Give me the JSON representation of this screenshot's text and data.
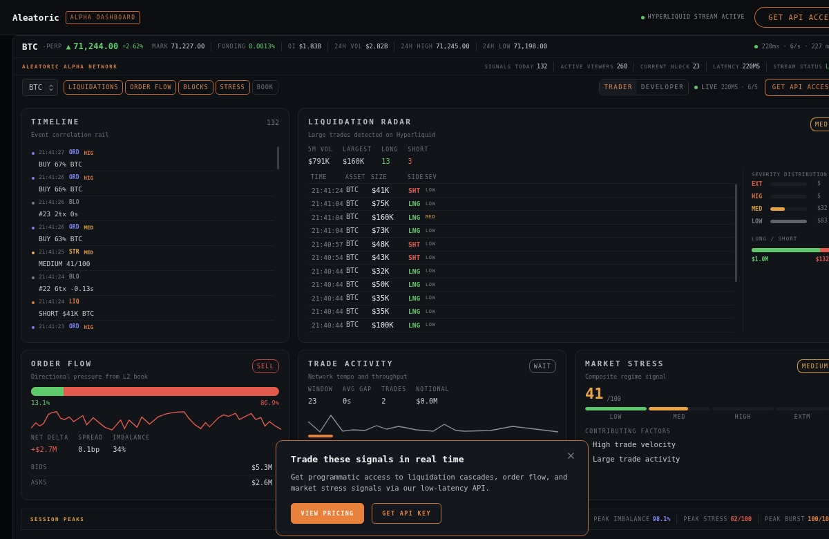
{
  "header": {
    "brand": "Aleatoric",
    "badge": "ALPHA DASHBOARD",
    "stream": {
      "label": "HYPERLIQUID STREAM ACTIVE",
      "active": true
    },
    "cta": "GET API ACCE"
  },
  "ticker": {
    "symbol": "BTC",
    "suffix": "-PERP",
    "rising": true,
    "arrow": "▲",
    "price": "71,244.00",
    "change": "+2.62%",
    "stats": [
      {
        "label": "MARK",
        "value": "71,227.00",
        "kind": "plain"
      },
      {
        "label": "FUNDING",
        "value": "0.0013%",
        "kind": "positive"
      },
      {
        "label": "OI",
        "value": "$1.83B",
        "kind": "plain"
      },
      {
        "label": "24H VOL",
        "value": "$2.82B",
        "kind": "plain"
      },
      {
        "label": "24H HIGH",
        "value": "71,245.00",
        "kind": "plain"
      },
      {
        "label": "24H LOW",
        "value": "71,198.00",
        "kind": "plain"
      }
    ],
    "live": {
      "active": true,
      "text": "220ms · 6/s · 227 m"
    }
  },
  "network": {
    "title": "ALEATORIC ALPHA NETWORK",
    "stats": [
      {
        "label": "SIGNALS TODAY",
        "value": "132",
        "kind": "plain"
      },
      {
        "label": "ACTIVE VIEWERS",
        "value": "260",
        "kind": "plain"
      },
      {
        "label": "CURRENT BLOCK",
        "value": "23",
        "kind": "plain"
      },
      {
        "label": "LATENCY",
        "value": "220MS",
        "kind": "plain"
      },
      {
        "label": "STREAM STATUS",
        "value": "L",
        "kind": "positive"
      }
    ]
  },
  "toolbar": {
    "asset_select": {
      "value": "BTC"
    },
    "filters": [
      {
        "label": "LIQUIDATIONS",
        "on": true
      },
      {
        "label": "ORDER FLOW",
        "on": true
      },
      {
        "label": "BLOCKS",
        "on": true
      },
      {
        "label": "STRESS",
        "on": true
      },
      {
        "label": "BOOK",
        "on": false
      }
    ],
    "modes": [
      {
        "label": "TRADER",
        "selected": true
      },
      {
        "label": "DEVELOPER",
        "selected": false
      }
    ],
    "live": {
      "active": true,
      "label": "LIVE",
      "detail": "220MS · 6/S"
    },
    "cta": "GET API ACCES"
  },
  "timeline": {
    "title": "TIMELINE",
    "count": "132",
    "subtitle": "Event correlation rail",
    "events": [
      {
        "time": "21:41:27",
        "type": "ORD",
        "color": "#7b86f2",
        "severity": {
          "text": "HIG",
          "kind": "high"
        },
        "text": "BUY 67% BTC"
      },
      {
        "time": "21:41:26",
        "type": "ORD",
        "color": "#7b86f2",
        "severity": {
          "text": "HIG",
          "kind": "high"
        },
        "text": "BUY 66% BTC"
      },
      {
        "time": "21:41:26",
        "type": "BLO",
        "color": "#7a7e86",
        "text": "#23 2tx 0s"
      },
      {
        "time": "21:41:26",
        "type": "ORD",
        "color": "#7b86f2",
        "severity": {
          "text": "MED",
          "kind": "medium"
        },
        "text": "BUY 63% BTC"
      },
      {
        "time": "21:41:25",
        "type": "STR",
        "color": "#e3b04f",
        "severity": {
          "text": "MED",
          "kind": "medium"
        },
        "text": "MEDIUM 41/100"
      },
      {
        "time": "21:41:24",
        "type": "BLO",
        "color": "#7a7e86",
        "text": "#22 6tx -0.13s"
      },
      {
        "time": "21:41:24",
        "type": "LIQ",
        "color": "#e2843f",
        "text": "SHORT $41K BTC"
      },
      {
        "time": "21:41:23",
        "type": "ORD",
        "color": "#7b86f2",
        "severity": {
          "text": "HIG",
          "kind": "high"
        }
      }
    ]
  },
  "radar": {
    "title": "LIQUIDATION RADAR",
    "subtitle": "Large trades detected on Hyperliquid",
    "badge": {
      "text": "MED",
      "kind": "medium"
    },
    "stats": [
      {
        "label": "5M VOL",
        "value": "$791K",
        "kind": "plain"
      },
      {
        "label": "LARGEST",
        "value": "$160K",
        "kind": "plain"
      },
      {
        "label": "LONG",
        "value": "13",
        "kind": "positive"
      },
      {
        "label": "SHORT",
        "value": "3",
        "kind": "negative"
      }
    ],
    "table": {
      "columns": [
        "TIME",
        "ASSET",
        "SIZE",
        "SIDE",
        "SEV"
      ],
      "rows": [
        {
          "time": "21:41:24",
          "asset": "BTC",
          "size": "$41K",
          "side": {
            "text": "SHT",
            "kind": "short"
          },
          "sev": {
            "text": "LOW",
            "kind": "low"
          }
        },
        {
          "time": "21:41:04",
          "asset": "BTC",
          "size": "$75K",
          "side": {
            "text": "LNG",
            "kind": "long"
          },
          "sev": {
            "text": "LOW",
            "kind": "low"
          }
        },
        {
          "time": "21:41:04",
          "asset": "BTC",
          "size": "$160K",
          "side": {
            "text": "LNG",
            "kind": "long"
          },
          "sev": {
            "text": "MED",
            "kind": "medium"
          }
        },
        {
          "time": "21:41:04",
          "asset": "BTC",
          "size": "$73K",
          "side": {
            "text": "LNG",
            "kind": "long"
          },
          "sev": {
            "text": "LOW",
            "kind": "low"
          }
        },
        {
          "time": "21:40:57",
          "asset": "BTC",
          "size": "$48K",
          "side": {
            "text": "SHT",
            "kind": "short"
          },
          "sev": {
            "text": "LOW",
            "kind": "low"
          }
        },
        {
          "time": "21:40:54",
          "asset": "BTC",
          "size": "$43K",
          "side": {
            "text": "SHT",
            "kind": "short"
          },
          "sev": {
            "text": "LOW",
            "kind": "low"
          }
        },
        {
          "time": "21:40:44",
          "asset": "BTC",
          "size": "$32K",
          "side": {
            "text": "LNG",
            "kind": "long"
          },
          "sev": {
            "text": "LOW",
            "kind": "low"
          }
        },
        {
          "time": "21:40:44",
          "asset": "BTC",
          "size": "$50K",
          "side": {
            "text": "LNG",
            "kind": "long"
          },
          "sev": {
            "text": "LOW",
            "kind": "low"
          }
        },
        {
          "time": "21:40:44",
          "asset": "BTC",
          "size": "$35K",
          "side": {
            "text": "LNG",
            "kind": "long"
          },
          "sev": {
            "text": "LOW",
            "kind": "low"
          }
        },
        {
          "time": "21:40:44",
          "asset": "BTC",
          "size": "$35K",
          "side": {
            "text": "LNG",
            "kind": "long"
          },
          "sev": {
            "text": "LOW",
            "kind": "low"
          }
        },
        {
          "time": "21:40:44",
          "asset": "BTC",
          "size": "$100K",
          "side": {
            "text": "LNG",
            "kind": "long"
          },
          "sev": {
            "text": "LOW",
            "kind": "low"
          }
        }
      ]
    },
    "severity": {
      "title": "SEVERITY DISTRIBUTION",
      "rows": [
        {
          "label": "EXT",
          "kind": "extreme",
          "value": "$"
        },
        {
          "label": "HIG",
          "kind": "high",
          "value": "$"
        },
        {
          "label": "MED",
          "kind": "medium",
          "level": 0.39,
          "value": "$32"
        },
        {
          "label": "LOW",
          "kind": "low",
          "level": 1,
          "value": "$83"
        }
      ]
    },
    "long_short": {
      "title": "LONG / SHORT",
      "level": 0.88,
      "long": "$1.0M",
      "short": "$132"
    }
  },
  "order_flow": {
    "title": "ORDER FLOW",
    "subtitle": "Directional pressure from L2 book",
    "badge": {
      "text": "SELL",
      "kind": "sell"
    },
    "level": 0.131,
    "buy_pct": "13.1%",
    "sell_pct": "86.9%",
    "stats": [
      {
        "label": "NET DELTA",
        "value": "+$2.7M",
        "kind": "negative"
      },
      {
        "label": "SPREAD",
        "value": "0.1bp",
        "kind": "plain"
      },
      {
        "label": "IMBALANCE",
        "value": "34%",
        "kind": "plain"
      }
    ],
    "book": [
      {
        "label": "BIDS",
        "value": "$5.3M"
      },
      {
        "label": "ASKS",
        "value": "$2.6M"
      }
    ]
  },
  "trade_activity": {
    "title": "TRADE ACTIVITY",
    "subtitle": "Network tempo and throughput",
    "badge": {
      "text": "WAIT",
      "kind": "neutral"
    },
    "stats": [
      {
        "label": "WINDOW",
        "value": "23"
      },
      {
        "label": "AVG GAP",
        "value": "0s"
      },
      {
        "label": "TRADES",
        "value": "2"
      },
      {
        "label": "NOTIONAL",
        "value": "$0.0M"
      }
    ]
  },
  "market_stress": {
    "title": "MARKET STRESS",
    "subtitle": "Composite regime signal",
    "badge": {
      "text": "MEDIUM",
      "kind": "medium"
    },
    "score": "41",
    "scale": "/100",
    "segments": [
      {
        "label": "LOW",
        "kind": "low",
        "level": 1
      },
      {
        "label": "MED",
        "kind": "medium",
        "level": 0.64
      },
      {
        "label": "HIGH",
        "kind": "high"
      },
      {
        "label": "EXTM",
        "kind": "extreme"
      }
    ],
    "factors_title": "CONTRIBUTING FACTORS",
    "factors": [
      "High trade velocity",
      "Large trade activity"
    ]
  },
  "session_peaks": {
    "title": "SESSION PEAKS",
    "peaks": [
      {
        "label": "PEAK IMBALANCE",
        "value": "98.1%",
        "color": "#7f8cf5"
      },
      {
        "label": "PEAK STRESS",
        "value": "62/100",
        "color": "#e25a4b"
      },
      {
        "label": "PEAK BURST",
        "value": "100/10",
        "color": "#e2843f"
      }
    ]
  },
  "popup": {
    "title": "Trade these signals in real time",
    "body": "Get programmatic access to liquidation cascades, order flow, and market stress signals via our low-latency API.",
    "buttons": [
      {
        "label": "VIEW PRICING",
        "kind": "primary"
      },
      {
        "label": "GET API KEY",
        "kind": "outline"
      }
    ]
  }
}
